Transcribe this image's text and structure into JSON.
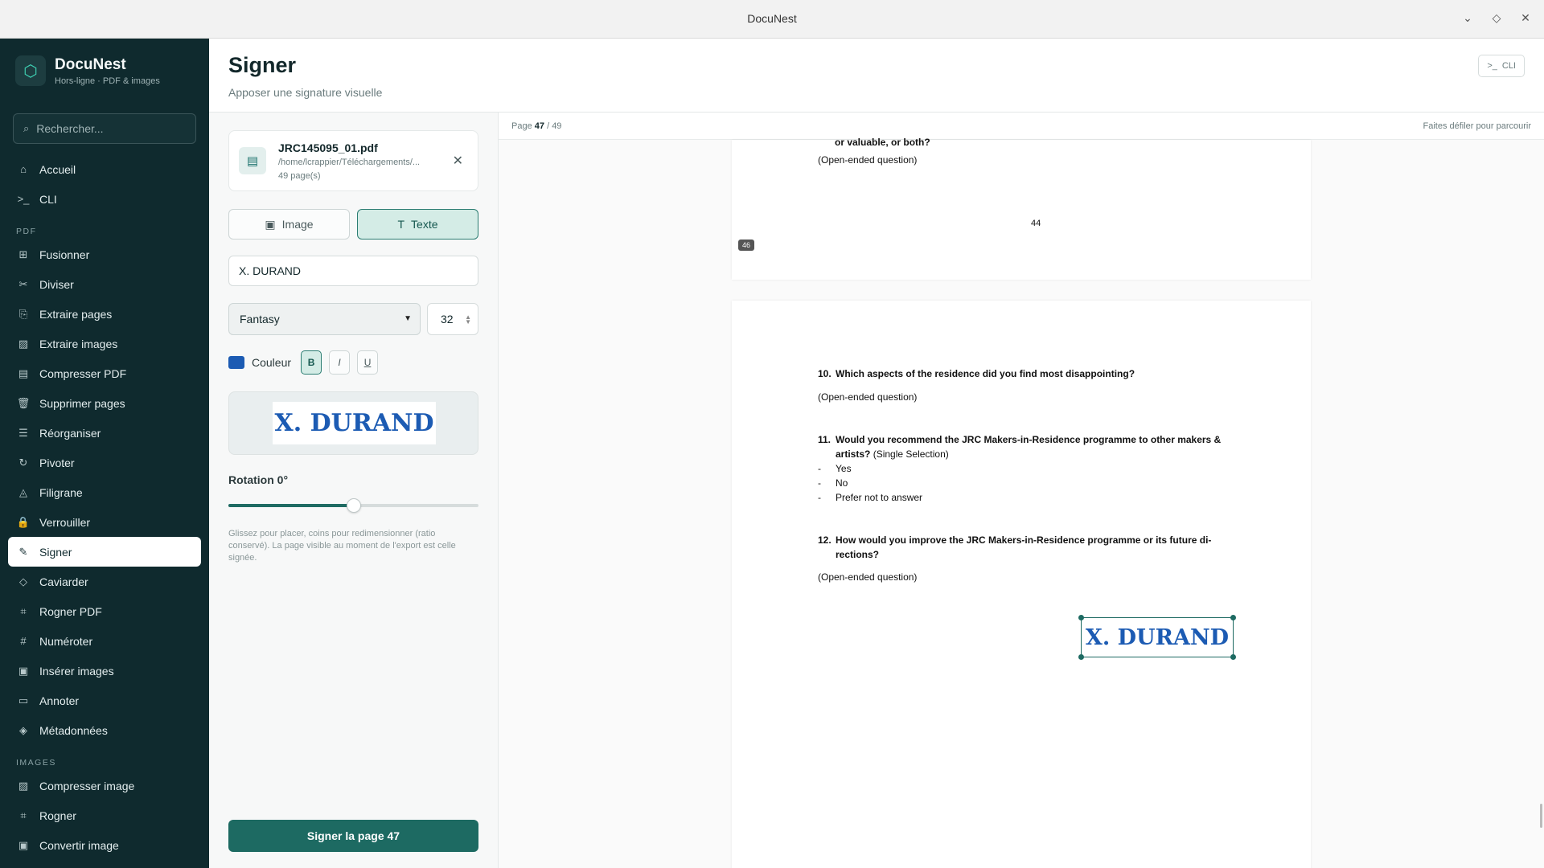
{
  "window": {
    "title": "DocuNest"
  },
  "sidebar": {
    "brand_name": "DocuNest",
    "brand_sub": "Hors-ligne · PDF & images",
    "search_placeholder": "Rechercher...",
    "items_top": [
      {
        "label": "Accueil",
        "icon": "⌂",
        "icon_name": "home-icon"
      },
      {
        "label": "CLI",
        "icon": ">_",
        "icon_name": "terminal-icon"
      }
    ],
    "section_pdf": "PDF",
    "items_pdf": [
      {
        "label": "Fusionner",
        "icon": "⊞",
        "icon_name": "merge-icon"
      },
      {
        "label": "Diviser",
        "icon": "✂",
        "icon_name": "scissors-icon"
      },
      {
        "label": "Extraire pages",
        "icon": "⎘",
        "icon_name": "extract-pages-icon"
      },
      {
        "label": "Extraire images",
        "icon": "▨",
        "icon_name": "extract-images-icon"
      },
      {
        "label": "Compresser PDF",
        "icon": "▤",
        "icon_name": "compress-icon"
      },
      {
        "label": "Supprimer pages",
        "icon": "🗑",
        "icon_name": "trash-icon"
      },
      {
        "label": "Réorganiser",
        "icon": "☰",
        "icon_name": "reorder-icon"
      },
      {
        "label": "Pivoter",
        "icon": "↻",
        "icon_name": "rotate-icon"
      },
      {
        "label": "Filigrane",
        "icon": "◬",
        "icon_name": "watermark-icon"
      },
      {
        "label": "Verrouiller",
        "icon": "🔒",
        "icon_name": "lock-icon"
      },
      {
        "label": "Signer",
        "icon": "✎",
        "icon_name": "pen-icon",
        "active": true
      },
      {
        "label": "Caviarder",
        "icon": "◇",
        "icon_name": "eraser-icon"
      },
      {
        "label": "Rogner PDF",
        "icon": "⌗",
        "icon_name": "crop-icon"
      },
      {
        "label": "Numéroter",
        "icon": "#",
        "icon_name": "hash-icon"
      },
      {
        "label": "Insérer images",
        "icon": "▣",
        "icon_name": "insert-image-icon"
      },
      {
        "label": "Annoter",
        "icon": "▭",
        "icon_name": "annotate-icon"
      },
      {
        "label": "Métadonnées",
        "icon": "◈",
        "icon_name": "tag-icon"
      }
    ],
    "section_images": "IMAGES",
    "items_images": [
      {
        "label": "Compresser image",
        "icon": "▨",
        "icon_name": "compress-image-icon"
      },
      {
        "label": "Rogner",
        "icon": "⌗",
        "icon_name": "crop-image-icon"
      },
      {
        "label": "Convertir image",
        "icon": "▣",
        "icon_name": "convert-image-icon"
      }
    ]
  },
  "header": {
    "title": "Signer",
    "subtitle": "Apposer une signature visuelle",
    "cli_label": "CLI"
  },
  "file": {
    "name": "JRC145095_01.pdf",
    "path": "/home/lcrappier/Téléchargements/...",
    "pages": "49 page(s)"
  },
  "tabs": {
    "image": "Image",
    "text": "Texte",
    "active": "text"
  },
  "signature": {
    "text_value": "X. DURAND",
    "font": "Fantasy",
    "size": "32",
    "color_label": "Couleur",
    "color": "#1c5bb3",
    "bold": true,
    "italic": false,
    "underline": false,
    "bold_label": "B",
    "italic_label": "I",
    "underline_label": "U",
    "preview_text": "X. DURAND"
  },
  "rotation": {
    "label": "Rotation 0°",
    "fraction": 0.5
  },
  "hint": "Glissez pour placer, coins pour redimensionner (ratio conservé). La page visible au moment de l'export est celle signée.",
  "sign_button": "Signer la page 47",
  "viewer": {
    "page_prefix": "Page",
    "current_page": "47",
    "total_pages": "/ 49",
    "scroll_hint": "Faites défiler pour parcourir",
    "page46": {
      "cut_text": "or valuable, or both?",
      "open": "(Open-ended question)",
      "page_number": "44",
      "badge": "46"
    },
    "page47": {
      "q10_num": "10.",
      "q10": "Which aspects of the residence did you find most disappointing?",
      "q10_open": "(Open-ended question)",
      "q11_num": "11.",
      "q11_line1": "Would you recommend the JRC Makers-in-Residence programme to other makers &",
      "q11_line2": "artists?",
      "q11_type": "(Single Selection)",
      "options": [
        "Yes",
        "No",
        "Prefer not to answer"
      ],
      "q12_num": "12.",
      "q12_line1": "How would you improve the JRC Makers-in-Residence programme or its future di-",
      "q12_line2": "rections?",
      "q12_open": "(Open-ended question)",
      "signature_text": "X. DURAND"
    }
  }
}
